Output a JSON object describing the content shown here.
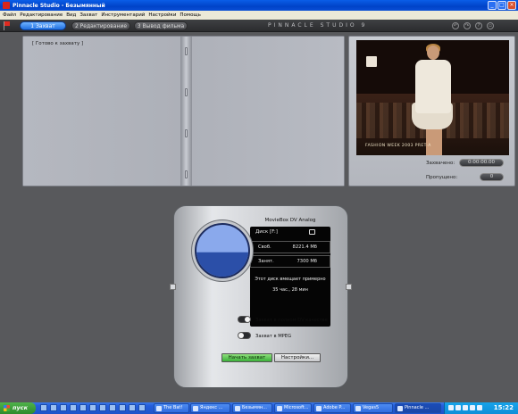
{
  "window": {
    "title": "Pinnacle Studio - Безымянный"
  },
  "menu": [
    "Файл",
    "Редактирование",
    "Вид",
    "Захват",
    "Инструментарий",
    "Настройки",
    "Помощь"
  ],
  "tabs": [
    {
      "label": "1 Захват",
      "active": true
    },
    {
      "label": "2 Редактирование",
      "active": false
    },
    {
      "label": "3 Вывод фильма",
      "active": false
    }
  ],
  "brand": "PINNACLE STUDIO 9",
  "capture_panel": {
    "status": "[ Готово к захвату ]"
  },
  "preview": {
    "video_caption": "FASHION WEEK 2003 PRET-A",
    "captured_label": "Захвачено:",
    "captured_value": "0:00:00.00",
    "dropped_label": "Пропущено:",
    "dropped_value": "0"
  },
  "device": {
    "name": "MovieBox DV Analog",
    "disk": "Диск [F:]",
    "free_label": "Своб.",
    "free_value": "8221.4 Мб",
    "used_label": "Занят.",
    "used_value": "7300 Мб",
    "remaining_text": "Этот диск вмещает примерно",
    "remaining_time": "35 час., 28 мин",
    "disk_used_fraction": 0.47,
    "option_dv": "Захват в полном DV-качестве",
    "option_mpeg": "Захват в MPEG",
    "start_button": "Начать захват",
    "settings_button": "Настройки..."
  },
  "taskbar": {
    "start": "пуск",
    "tasks": [
      "The Bat!",
      "Яндекс ...",
      "Безымян...",
      "Microsoft...",
      "Adobe P...",
      "Vegas5",
      "Pinnacle ..."
    ],
    "active_task": "Pinnacle ...",
    "clock": "15:22"
  },
  "colors": {
    "accent_tab": "#2a7ae8",
    "disk_used": "#2b4fa8",
    "disk_free": "#8aa9ec",
    "start_button": "#46b83f"
  }
}
